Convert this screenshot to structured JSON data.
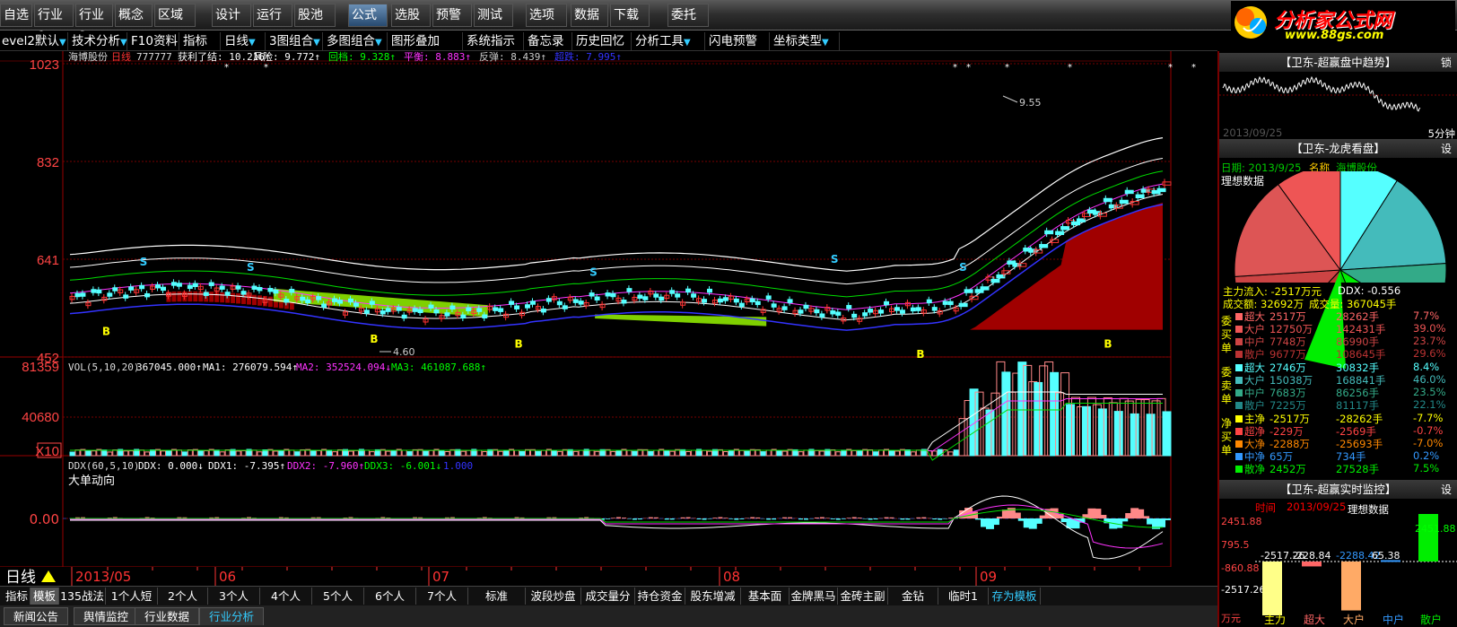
{
  "menu": [
    "自选",
    "行业1",
    "行业2",
    "概念",
    "区域",
    "设计",
    "运行",
    "股池",
    "公式",
    "选股",
    "预警",
    "测试",
    "选项",
    "数据",
    "下载",
    "委托"
  ],
  "logo": {
    "name": "分析家公式网",
    "url": "www.88gs.com"
  },
  "toolbar": [
    "evel2默认",
    "技术分析",
    "F10资料",
    "指标",
    "日线",
    "3图组合",
    "多图组合",
    "图形叠加",
    "系统指示",
    "备忘录",
    "历史回忆",
    "分析工具",
    "闪电预警",
    "坐标类型"
  ],
  "main_legend": {
    "name": "海博股份",
    "period": "日线",
    "code": "777777",
    "i1": "获利了结: 10.216",
    "i2": "风险: 9.772",
    "i3": "回档: 9.328",
    "i4": "平衡: 8.883",
    "i5": "反弹: 8.439",
    "i6": "超跌: 7.995"
  },
  "price_axis": [
    "1023",
    "832",
    "641",
    "452"
  ],
  "annot": {
    "high": "9.55",
    "low": "4.60"
  },
  "vol_axis": [
    "81359",
    "40680",
    "X10"
  ],
  "vol_legend": {
    "a": "VOL(5,10,20)",
    "b": "367045.000",
    "c": "MA1: 276079.594",
    "d": "MA2: 352524.094",
    "e": "MA3: 461087.688"
  },
  "ddx_legend": {
    "a": "DDX(60,5,10)",
    "b": "DDX: 0.000",
    "c": "DDX1: -7.395",
    "d": "DDX2: -7.960",
    "e": "DDX3: -6.001",
    "f": "1.000",
    "title": "大单动向"
  },
  "ddx_axis": [
    "0.00"
  ],
  "time_axis": {
    "period": "日线",
    "months": [
      "2013/05",
      "06",
      "07",
      "08",
      "09"
    ]
  },
  "bottom_tabs": [
    "指标",
    "模板",
    "135战法",
    "1个人短线",
    "2个人",
    "3个人",
    "4个人",
    "5个人",
    "6个人",
    "7个人",
    "标准",
    "波段炒盘",
    "成交量分析",
    "持仓资金",
    "股东增减",
    "基本面",
    "金牌黑马",
    "金砖主副",
    "金钻",
    "临时1",
    "存为模板"
  ],
  "bottom_tabs2": [
    "新闻公告",
    "舆情监控",
    "行业数据",
    "行业分析"
  ],
  "right": {
    "p1_title": "【卫东-超赢盘中趋势】",
    "p1_btn": "锁",
    "p1_date": "2013/09/25",
    "p1_label": "5分钟",
    "p2_title": "【卫东-龙虎看盘】",
    "p2_btn": "设",
    "date": "日期: 2013/9/25",
    "name": "名称",
    "stock": "海博股份",
    "ideal": "理想数据",
    "pie_l1": "主力流入: -2517万元",
    "pie_l2": "DDX: -0.556",
    "pie_l3": "成交额: 32692万",
    "pie_l4": "成交量: 367045手",
    "buy": {
      "label": "委买单",
      "rows": [
        [
          "超大",
          "2517万",
          "28262手",
          "7.7%"
        ],
        [
          "大户",
          "12750万",
          "142431手",
          "39.0%"
        ],
        [
          "中户",
          "7748万",
          "86990手",
          "23.7%"
        ],
        [
          "散户",
          "9677万",
          "108645手",
          "29.6%"
        ]
      ]
    },
    "sell": {
      "label": "委卖单",
      "rows": [
        [
          "超大",
          "2746万",
          "30832手",
          "8.4%"
        ],
        [
          "大户",
          "15038万",
          "168841手",
          "46.0%"
        ],
        [
          "中户",
          "7683万",
          "86256手",
          "23.5%"
        ],
        [
          "散户",
          "7225万",
          "81117手",
          "22.1%"
        ]
      ]
    },
    "net": {
      "label": "净买单",
      "rows": [
        [
          "主净",
          "-2517万",
          "-28262手",
          "-7.7%"
        ],
        [
          "超净",
          "-229万",
          "-2569手",
          "-0.7%"
        ],
        [
          "大净",
          "-2288万",
          "-25693手",
          "-7.0%"
        ],
        [
          "中净",
          "65万",
          "734手",
          "0.2%"
        ],
        [
          "散净",
          "2452万",
          "27528手",
          "7.5%"
        ]
      ]
    },
    "p3_title": "【卫东-超赢实时监控】",
    "p3_btn": "设",
    "p3_time": "时间",
    "p3_date": "2013/09/25",
    "p3_ideal": "理想数据",
    "bar_axis": [
      "2451.88",
      "795.5",
      "-860.88",
      "-2517.26",
      "万元"
    ],
    "bar_vals": [
      "2451.88",
      "-2517.26",
      "-228.84",
      "-2288.42",
      "65.38"
    ],
    "bar_labels": [
      "主力",
      "超大",
      "大户",
      "中户",
      "散户"
    ]
  }
}
